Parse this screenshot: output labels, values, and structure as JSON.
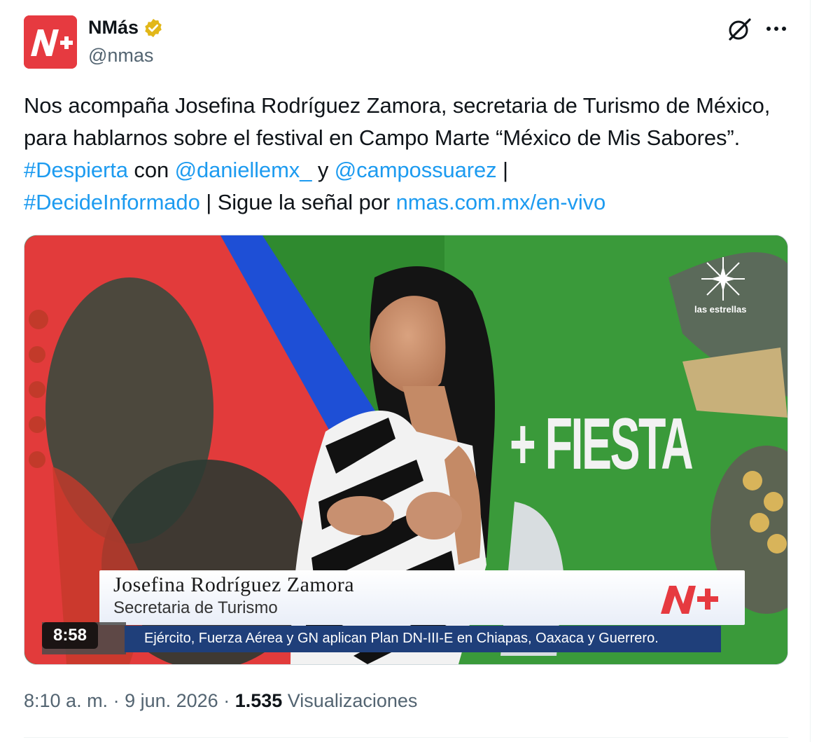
{
  "author": {
    "display_name": "NMás",
    "handle": "@nmas",
    "avatar_text": "N+",
    "verified_icon": "verified-badge-gold"
  },
  "actions": {
    "grok_icon": "grok-icon",
    "more_icon": "more-icon"
  },
  "tweet": {
    "part1": "Nos acompaña Josefina Rodríguez Zamora, secretaria de Turismo de México, para hablarnos sobre el festival en Campo Marte “México de Mis Sabores”. ",
    "hashtag1": "#Despierta",
    "part2": " con ",
    "mention1": "@daniellemx_",
    "part3": " y ",
    "mention2": "@campossuarez",
    "part4": " | ",
    "hashtag2": "#DecideInformado",
    "part5": " | Sigue la señal por ",
    "link": "nmas.com.mx/en-vivo"
  },
  "video": {
    "timestamp": "8:58",
    "channel_label": "las estrellas",
    "backdrop_text": "+ FIESTA",
    "lower_third_name": "Josefina Rodríguez Zamora",
    "lower_third_role": "Secretaria de Turismo",
    "lower_third_logo": "N+",
    "ticker": "Ejército, Fuerza Aérea y GN aplican Plan DN-III-E en Chiapas, Oaxaca y Guerrero."
  },
  "meta": {
    "time": "8:10 a. m.",
    "sep1": " · ",
    "date": "9 jun. 2026",
    "sep2": " · ",
    "views_count": "1.535",
    "views_label": " Visualizaciones"
  },
  "colors": {
    "link": "#1d9bf0",
    "brand_red": "#e63a40",
    "verified": "#e2b719",
    "text_secondary": "#536471"
  }
}
